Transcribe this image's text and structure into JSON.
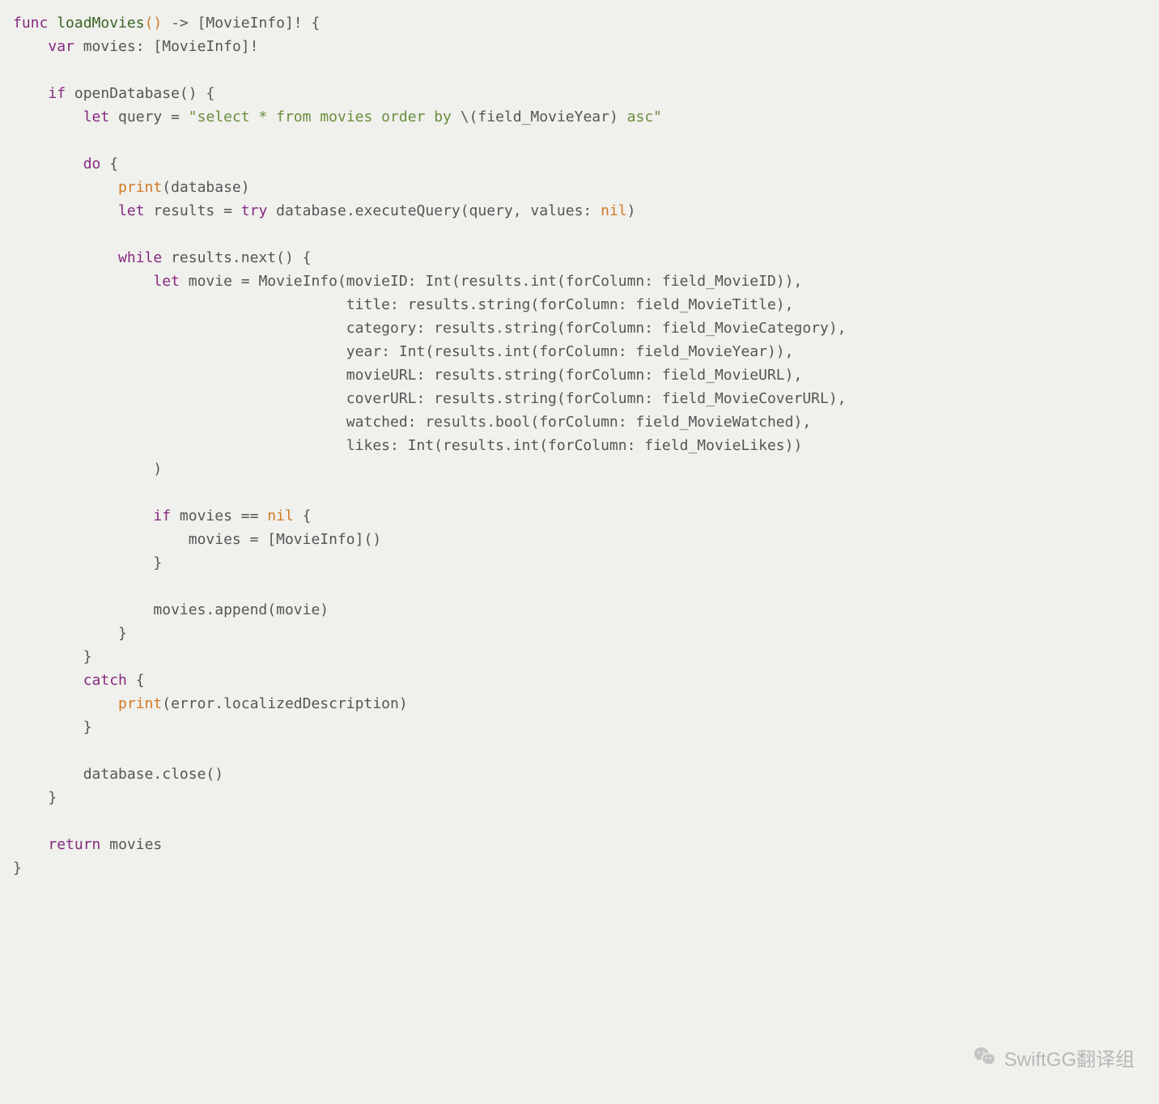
{
  "code": {
    "lines": [
      {
        "tokens": [
          {
            "t": "func ",
            "c": "kw"
          },
          {
            "t": "loadMovies",
            "c": "fn"
          },
          {
            "t": "()",
            "c": "or"
          },
          {
            "t": " -> [MovieInfo]! {",
            "c": "id"
          }
        ]
      },
      {
        "tokens": [
          {
            "t": "    ",
            "c": ""
          },
          {
            "t": "var",
            "c": "kw"
          },
          {
            "t": " movies: [MovieInfo]!",
            "c": "id"
          }
        ]
      },
      {
        "tokens": [
          {
            "t": "",
            "c": ""
          }
        ]
      },
      {
        "tokens": [
          {
            "t": "    ",
            "c": ""
          },
          {
            "t": "if",
            "c": "kw"
          },
          {
            "t": " openDatabase() {",
            "c": "id"
          }
        ]
      },
      {
        "tokens": [
          {
            "t": "        ",
            "c": ""
          },
          {
            "t": "let",
            "c": "kw"
          },
          {
            "t": " query = ",
            "c": "id"
          },
          {
            "t": "\"select * from movies order by ",
            "c": "str"
          },
          {
            "t": "\\(",
            "c": "id"
          },
          {
            "t": "field_MovieYear",
            "c": "id"
          },
          {
            "t": ")",
            "c": "id"
          },
          {
            "t": " asc\"",
            "c": "str"
          }
        ]
      },
      {
        "tokens": [
          {
            "t": "",
            "c": ""
          }
        ]
      },
      {
        "tokens": [
          {
            "t": "        ",
            "c": ""
          },
          {
            "t": "do",
            "c": "kw"
          },
          {
            "t": " {",
            "c": "id"
          }
        ]
      },
      {
        "tokens": [
          {
            "t": "            ",
            "c": ""
          },
          {
            "t": "print",
            "c": "or"
          },
          {
            "t": "(database)",
            "c": "id"
          }
        ]
      },
      {
        "tokens": [
          {
            "t": "            ",
            "c": ""
          },
          {
            "t": "let",
            "c": "kw"
          },
          {
            "t": " results = ",
            "c": "id"
          },
          {
            "t": "try",
            "c": "kw"
          },
          {
            "t": " database.executeQuery(query, values: ",
            "c": "id"
          },
          {
            "t": "nil",
            "c": "or"
          },
          {
            "t": ")",
            "c": "id"
          }
        ]
      },
      {
        "tokens": [
          {
            "t": "",
            "c": ""
          }
        ]
      },
      {
        "tokens": [
          {
            "t": "            ",
            "c": ""
          },
          {
            "t": "while",
            "c": "kw"
          },
          {
            "t": " results.next() {",
            "c": "id"
          }
        ]
      },
      {
        "tokens": [
          {
            "t": "                ",
            "c": ""
          },
          {
            "t": "let",
            "c": "kw"
          },
          {
            "t": " movie = MovieInfo(movieID: Int(results.int(forColumn: field_MovieID)),",
            "c": "id"
          }
        ]
      },
      {
        "tokens": [
          {
            "t": "                                      title: results.string(forColumn: field_MovieTitle),",
            "c": "id"
          }
        ]
      },
      {
        "tokens": [
          {
            "t": "                                      category: results.string(forColumn: field_MovieCategory),",
            "c": "id"
          }
        ]
      },
      {
        "tokens": [
          {
            "t": "                                      year: Int(results.int(forColumn: field_MovieYear)),",
            "c": "id"
          }
        ]
      },
      {
        "tokens": [
          {
            "t": "                                      movieURL: results.string(forColumn: field_MovieURL),",
            "c": "id"
          }
        ]
      },
      {
        "tokens": [
          {
            "t": "                                      coverURL: results.string(forColumn: field_MovieCoverURL),",
            "c": "id"
          }
        ]
      },
      {
        "tokens": [
          {
            "t": "                                      watched: results.bool(forColumn: field_MovieWatched),",
            "c": "id"
          }
        ]
      },
      {
        "tokens": [
          {
            "t": "                                      likes: Int(results.int(forColumn: field_MovieLikes))",
            "c": "id"
          }
        ]
      },
      {
        "tokens": [
          {
            "t": "                )",
            "c": "id"
          }
        ]
      },
      {
        "tokens": [
          {
            "t": "",
            "c": ""
          }
        ]
      },
      {
        "tokens": [
          {
            "t": "                ",
            "c": ""
          },
          {
            "t": "if",
            "c": "kw"
          },
          {
            "t": " movies == ",
            "c": "id"
          },
          {
            "t": "nil",
            "c": "or"
          },
          {
            "t": " {",
            "c": "id"
          }
        ]
      },
      {
        "tokens": [
          {
            "t": "                    movies = [MovieInfo]()",
            "c": "id"
          }
        ]
      },
      {
        "tokens": [
          {
            "t": "                }",
            "c": "id"
          }
        ]
      },
      {
        "tokens": [
          {
            "t": "",
            "c": ""
          }
        ]
      },
      {
        "tokens": [
          {
            "t": "                movies.append(movie)",
            "c": "id"
          }
        ]
      },
      {
        "tokens": [
          {
            "t": "            }",
            "c": "id"
          }
        ]
      },
      {
        "tokens": [
          {
            "t": "        }",
            "c": "id"
          }
        ]
      },
      {
        "tokens": [
          {
            "t": "        ",
            "c": ""
          },
          {
            "t": "catch",
            "c": "kw"
          },
          {
            "t": " {",
            "c": "id"
          }
        ]
      },
      {
        "tokens": [
          {
            "t": "            ",
            "c": ""
          },
          {
            "t": "print",
            "c": "or"
          },
          {
            "t": "(error.localizedDescription)",
            "c": "id"
          }
        ]
      },
      {
        "tokens": [
          {
            "t": "        }",
            "c": "id"
          }
        ]
      },
      {
        "tokens": [
          {
            "t": "",
            "c": ""
          }
        ]
      },
      {
        "tokens": [
          {
            "t": "        database.close()",
            "c": "id"
          }
        ]
      },
      {
        "tokens": [
          {
            "t": "    }",
            "c": "id"
          }
        ]
      },
      {
        "tokens": [
          {
            "t": "",
            "c": ""
          }
        ]
      },
      {
        "tokens": [
          {
            "t": "    ",
            "c": ""
          },
          {
            "t": "return",
            "c": "kw"
          },
          {
            "t": " movies",
            "c": "id"
          }
        ]
      },
      {
        "tokens": [
          {
            "t": "}",
            "c": "id"
          }
        ]
      }
    ]
  },
  "watermark": {
    "text": "SwiftGG翻译组"
  }
}
